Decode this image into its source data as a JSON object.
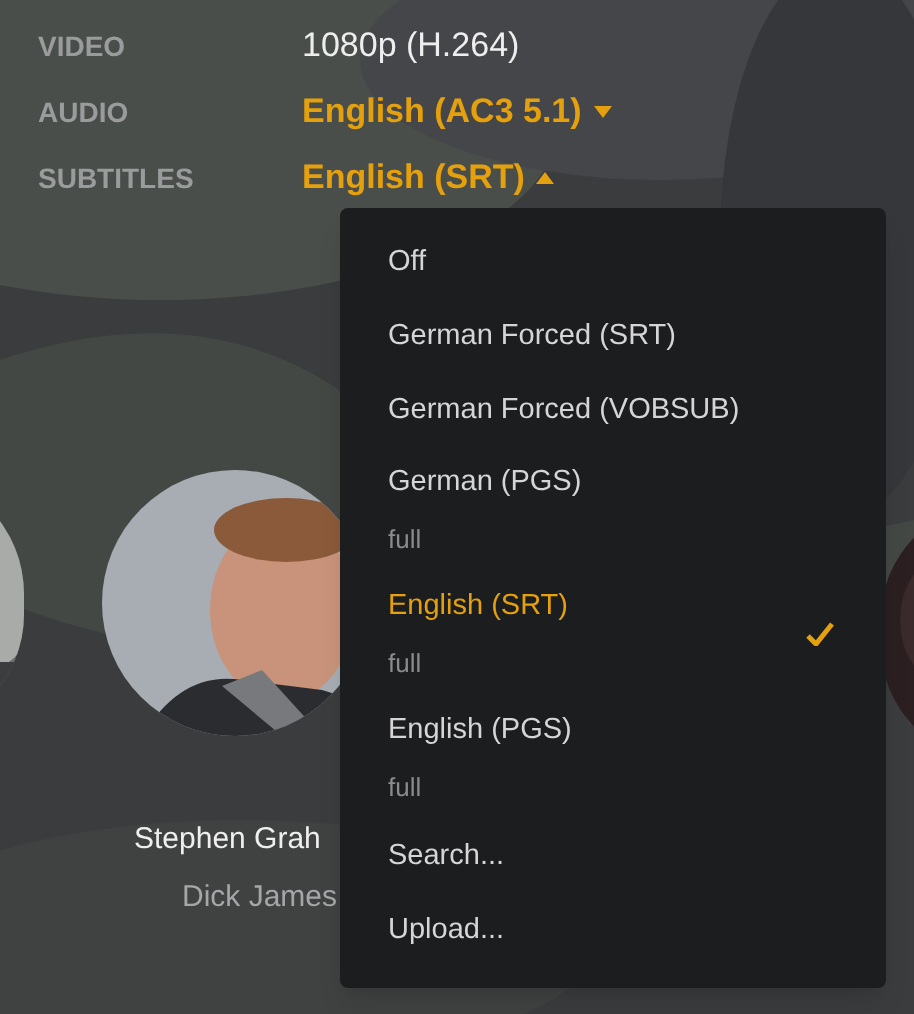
{
  "details": [
    {
      "label": "VIDEO",
      "value": "1080p (H.264)",
      "kind": "static"
    },
    {
      "label": "AUDIO",
      "value": "English (AC3 5.1)",
      "kind": "dropdown",
      "expanded": false
    },
    {
      "label": "SUBTITLES",
      "value": "English (SRT)",
      "kind": "dropdown",
      "expanded": true
    }
  ],
  "cast": [
    {
      "name": "Stephen Grah",
      "role": "Dick James"
    }
  ],
  "subtitle_menu": [
    {
      "label": "Off",
      "selected": false
    },
    {
      "label": "German Forced (SRT)",
      "selected": false
    },
    {
      "label": "German Forced (VOBSUB)",
      "selected": false
    },
    {
      "label": "German (PGS)",
      "detail": "full",
      "selected": false
    },
    {
      "label": "English (SRT)",
      "detail": "full",
      "selected": true
    },
    {
      "label": "English (PGS)",
      "detail": "full",
      "selected": false
    },
    {
      "label": "Search...",
      "selected": false
    },
    {
      "label": "Upload...",
      "selected": false
    }
  ]
}
